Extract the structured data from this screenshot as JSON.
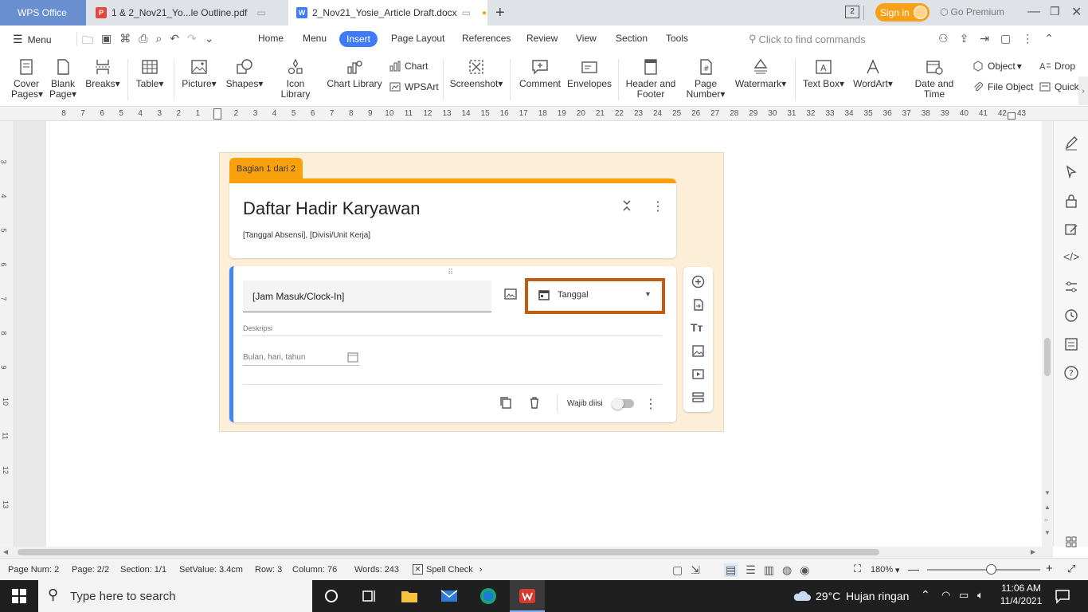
{
  "titlebar": {
    "tabs": [
      {
        "label": "WPS Office"
      },
      {
        "label": "1 & 2_Nov21_Yo...le Outline.pdf"
      },
      {
        "label": "2_Nov21_Yosie_Article Draft.docx"
      }
    ],
    "badge": "2",
    "signin": "Sign in",
    "premium": "Go Premium"
  },
  "menubar": {
    "menu": "Menu",
    "items": [
      "Home",
      "Menu",
      "Insert",
      "Page Layout",
      "References",
      "Review",
      "View",
      "Section",
      "Tools"
    ],
    "search_placeholder": "Click to find commands"
  },
  "ribbon": {
    "cover_pages": [
      "Cover",
      "Pages"
    ],
    "blank_page": [
      "Blank",
      "Page"
    ],
    "breaks": "Breaks",
    "table": "Table",
    "picture": "Picture",
    "shapes": "Shapes",
    "icon_library": "Icon Library",
    "chart_library": "Chart Library",
    "chart": "Chart",
    "wpsart": "WPSArt",
    "screenshot": "Screenshot",
    "comment": "Comment",
    "envelopes": "Envelopes",
    "header_footer": [
      "Header and",
      "Footer"
    ],
    "page_number": [
      "Page",
      "Number"
    ],
    "watermark": "Watermark",
    "text_box": "Text Box",
    "wordart": "WordArt",
    "date_time": "Date and Time",
    "object": "Object",
    "file_object": "File Object",
    "drop": "Drop",
    "quick": "Quick"
  },
  "ruler": {
    "labels": [
      "8",
      "7",
      "6",
      "5",
      "4",
      "3",
      "2",
      "1",
      "1",
      "2",
      "3",
      "4",
      "5",
      "6",
      "7",
      "8",
      "9",
      "10",
      "11",
      "12",
      "13",
      "14",
      "15",
      "16",
      "17",
      "18",
      "19",
      "20",
      "21",
      "22",
      "23",
      "24",
      "25",
      "26",
      "27",
      "28",
      "29",
      "30",
      "31",
      "32",
      "33",
      "34",
      "35",
      "36",
      "37",
      "38",
      "39",
      "40",
      "41",
      "42",
      "43"
    ],
    "vlabels": [
      "3",
      "4",
      "5",
      "6",
      "7",
      "8",
      "9",
      "10",
      "11",
      "12",
      "13"
    ]
  },
  "form": {
    "section_tab": "Bagian 1 dari 2",
    "title": "Daftar Hadir Karyawan",
    "subtitle": "[Tanggal Absensi], [Divisi/Unit Kerja]",
    "question": "[Jam Masuk/Clock-In]",
    "type": "Tanggal",
    "description": "Deskripsi",
    "date_placeholder": "Bulan, hari, tahun",
    "required": "Wajib diisi"
  },
  "statusbar": {
    "page_num": "Page Num: 2",
    "page": "Page: 2/2",
    "section": "Section: 1/1",
    "setvalue": "SetValue: 3.4cm",
    "row": "Row: 3",
    "column": "Column: 76",
    "words": "Words: 243",
    "spell": "Spell Check",
    "zoom": "180%"
  },
  "taskbar": {
    "search_placeholder": "Type here to search",
    "weather_temp": "29°C",
    "weather_desc": "Hujan ringan",
    "time": "11:06 AM",
    "date": "11/4/2021"
  },
  "colors": {
    "accent": "#3d7bf7",
    "form_orange": "#f9a10d",
    "highlight_box": "#c05b12",
    "form_blue": "#4285f4"
  }
}
